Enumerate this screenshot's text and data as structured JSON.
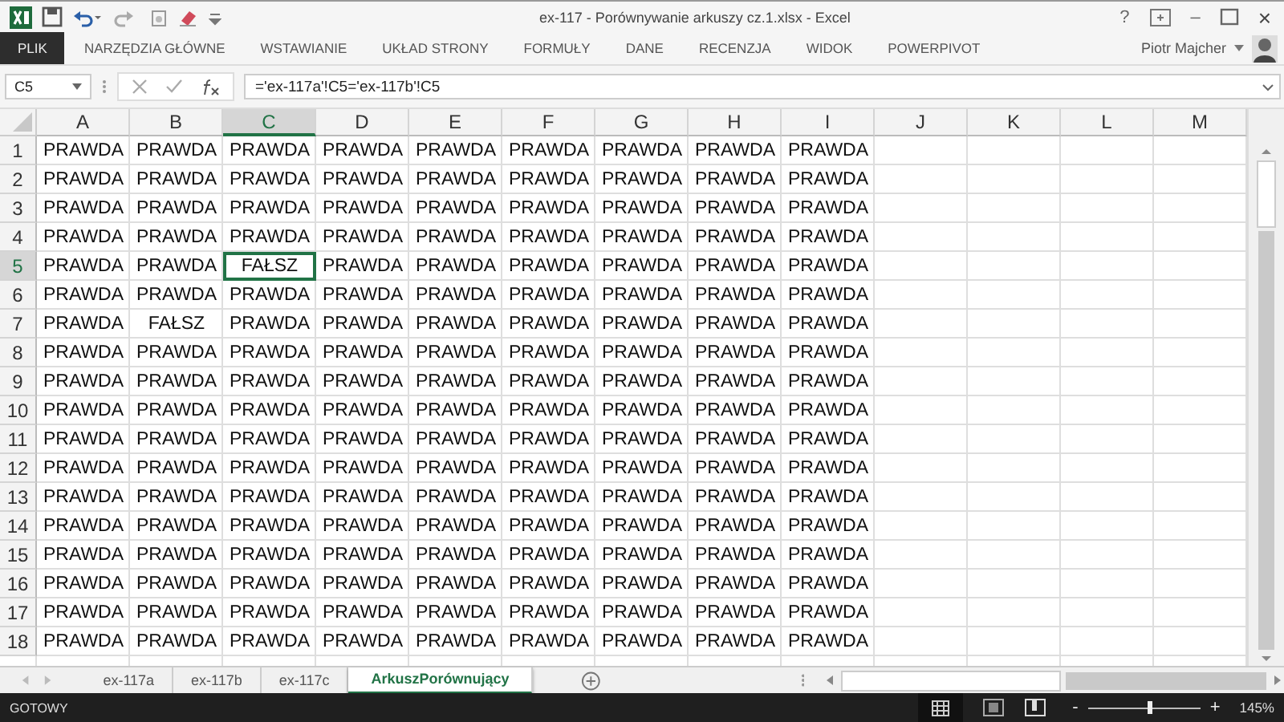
{
  "window": {
    "title": "ex-117 - Porównywanie arkuszy cz.1.xlsx - Excel",
    "controls": [
      "?",
      "–",
      "×"
    ]
  },
  "ribbon": {
    "tabs": [
      {
        "label": "PLIK",
        "kind": "file",
        "selected": false
      },
      {
        "label": "NARZĘDZIA GŁÓWNE",
        "kind": "tab",
        "selected": false
      },
      {
        "label": "WSTAWIANIE",
        "kind": "tab",
        "selected": false
      },
      {
        "label": "UKŁAD STRONY",
        "kind": "tab",
        "selected": false
      },
      {
        "label": "FORMUŁY",
        "kind": "tab",
        "selected": false
      },
      {
        "label": "DANE",
        "kind": "tab",
        "selected": false
      },
      {
        "label": "RECENZJA",
        "kind": "tab",
        "selected": false
      },
      {
        "label": "WIDOK",
        "kind": "tab",
        "selected": false
      },
      {
        "label": "POWERPIVOT",
        "kind": "tab",
        "selected": false
      }
    ],
    "user": "Piotr Majcher"
  },
  "formula_bar": {
    "name_box": "C5",
    "formula": "='ex-117a'!C5='ex-117b'!C5"
  },
  "sheet": {
    "columns": [
      {
        "label": "A",
        "selected": false
      },
      {
        "label": "B",
        "selected": false
      },
      {
        "label": "C",
        "selected": true
      },
      {
        "label": "D",
        "selected": false
      },
      {
        "label": "E",
        "selected": false
      },
      {
        "label": "F",
        "selected": false
      },
      {
        "label": "G",
        "selected": false
      },
      {
        "label": "H",
        "selected": false
      },
      {
        "label": "I",
        "selected": false
      },
      {
        "label": "J",
        "selected": false
      },
      {
        "label": "K",
        "selected": false
      },
      {
        "label": "L",
        "selected": false
      },
      {
        "label": "M",
        "selected": false
      }
    ],
    "rows": [
      {
        "header": "1",
        "selected": false,
        "cells": [
          "PRAWDA",
          "PRAWDA",
          "PRAWDA",
          "PRAWDA",
          "PRAWDA",
          "PRAWDA",
          "PRAWDA",
          "PRAWDA",
          "PRAWDA"
        ]
      },
      {
        "header": "2",
        "selected": false,
        "cells": [
          "PRAWDA",
          "PRAWDA",
          "PRAWDA",
          "PRAWDA",
          "PRAWDA",
          "PRAWDA",
          "PRAWDA",
          "PRAWDA",
          "PRAWDA"
        ]
      },
      {
        "header": "3",
        "selected": false,
        "cells": [
          "PRAWDA",
          "PRAWDA",
          "PRAWDA",
          "PRAWDA",
          "PRAWDA",
          "PRAWDA",
          "PRAWDA",
          "PRAWDA",
          "PRAWDA"
        ]
      },
      {
        "header": "4",
        "selected": false,
        "cells": [
          "PRAWDA",
          "PRAWDA",
          "PRAWDA",
          "PRAWDA",
          "PRAWDA",
          "PRAWDA",
          "PRAWDA",
          "PRAWDA",
          "PRAWDA"
        ]
      },
      {
        "header": "5",
        "selected": true,
        "cells": [
          "PRAWDA",
          "PRAWDA",
          "FAŁSZ",
          "PRAWDA",
          "PRAWDA",
          "PRAWDA",
          "PRAWDA",
          "PRAWDA",
          "PRAWDA"
        ]
      },
      {
        "header": "6",
        "selected": false,
        "cells": [
          "PRAWDA",
          "PRAWDA",
          "PRAWDA",
          "PRAWDA",
          "PRAWDA",
          "PRAWDA",
          "PRAWDA",
          "PRAWDA",
          "PRAWDA"
        ]
      },
      {
        "header": "7",
        "selected": false,
        "cells": [
          "PRAWDA",
          "FAŁSZ",
          "PRAWDA",
          "PRAWDA",
          "PRAWDA",
          "PRAWDA",
          "PRAWDA",
          "PRAWDA",
          "PRAWDA"
        ]
      },
      {
        "header": "8",
        "selected": false,
        "cells": [
          "PRAWDA",
          "PRAWDA",
          "PRAWDA",
          "PRAWDA",
          "PRAWDA",
          "PRAWDA",
          "PRAWDA",
          "PRAWDA",
          "PRAWDA"
        ]
      },
      {
        "header": "9",
        "selected": false,
        "cells": [
          "PRAWDA",
          "PRAWDA",
          "PRAWDA",
          "PRAWDA",
          "PRAWDA",
          "PRAWDA",
          "PRAWDA",
          "PRAWDA",
          "PRAWDA"
        ]
      },
      {
        "header": "10",
        "selected": false,
        "cells": [
          "PRAWDA",
          "PRAWDA",
          "PRAWDA",
          "PRAWDA",
          "PRAWDA",
          "PRAWDA",
          "PRAWDA",
          "PRAWDA",
          "PRAWDA"
        ]
      },
      {
        "header": "11",
        "selected": false,
        "cells": [
          "PRAWDA",
          "PRAWDA",
          "PRAWDA",
          "PRAWDA",
          "PRAWDA",
          "PRAWDA",
          "PRAWDA",
          "PRAWDA",
          "PRAWDA"
        ]
      },
      {
        "header": "12",
        "selected": false,
        "cells": [
          "PRAWDA",
          "PRAWDA",
          "PRAWDA",
          "PRAWDA",
          "PRAWDA",
          "PRAWDA",
          "PRAWDA",
          "PRAWDA",
          "PRAWDA"
        ]
      },
      {
        "header": "13",
        "selected": false,
        "cells": [
          "PRAWDA",
          "PRAWDA",
          "PRAWDA",
          "PRAWDA",
          "PRAWDA",
          "PRAWDA",
          "PRAWDA",
          "PRAWDA",
          "PRAWDA"
        ]
      },
      {
        "header": "14",
        "selected": false,
        "cells": [
          "PRAWDA",
          "PRAWDA",
          "PRAWDA",
          "PRAWDA",
          "PRAWDA",
          "PRAWDA",
          "PRAWDA",
          "PRAWDA",
          "PRAWDA"
        ]
      },
      {
        "header": "15",
        "selected": false,
        "cells": [
          "PRAWDA",
          "PRAWDA",
          "PRAWDA",
          "PRAWDA",
          "PRAWDA",
          "PRAWDA",
          "PRAWDA",
          "PRAWDA",
          "PRAWDA"
        ]
      },
      {
        "header": "16",
        "selected": false,
        "cells": [
          "PRAWDA",
          "PRAWDA",
          "PRAWDA",
          "PRAWDA",
          "PRAWDA",
          "PRAWDA",
          "PRAWDA",
          "PRAWDA",
          "PRAWDA"
        ]
      },
      {
        "header": "17",
        "selected": false,
        "cells": [
          "PRAWDA",
          "PRAWDA",
          "PRAWDA",
          "PRAWDA",
          "PRAWDA",
          "PRAWDA",
          "PRAWDA",
          "PRAWDA",
          "PRAWDA"
        ]
      },
      {
        "header": "18",
        "selected": false,
        "cells": [
          "PRAWDA",
          "PRAWDA",
          "PRAWDA",
          "PRAWDA",
          "PRAWDA",
          "PRAWDA",
          "PRAWDA",
          "PRAWDA",
          "PRAWDA"
        ]
      }
    ]
  },
  "sheet_tabs": [
    {
      "label": "ex-117a",
      "selected": false
    },
    {
      "label": "ex-117b",
      "selected": false
    },
    {
      "label": "ex-117c",
      "selected": false
    },
    {
      "label": "ArkuszPorównujący",
      "selected": true
    }
  ],
  "status_bar": {
    "status": "GOTOWY",
    "zoom": {
      "minus": "-",
      "level": 0.55,
      "plus": "+",
      "reading": "145%"
    }
  }
}
